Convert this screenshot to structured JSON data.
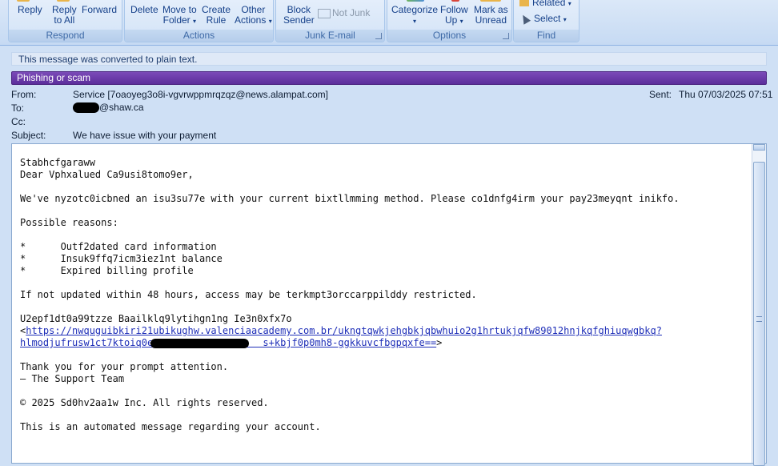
{
  "ribbon": {
    "respond": {
      "label": "Respond",
      "buttons": [
        {
          "l1": "Reply",
          "l2": ""
        },
        {
          "l1": "Reply",
          "l2": "to All"
        },
        {
          "l1": "Forward",
          "l2": ""
        }
      ]
    },
    "actions": {
      "label": "Actions",
      "buttons": [
        {
          "l1": "Delete",
          "l2": ""
        },
        {
          "l1": "Move to",
          "l2": "Folder"
        },
        {
          "l1": "Create",
          "l2": "Rule"
        },
        {
          "l1": "Other",
          "l2": "Actions"
        }
      ]
    },
    "junk": {
      "label": "Junk E-mail",
      "block": {
        "l1": "Block",
        "l2": "Sender"
      },
      "not_junk": "Not Junk"
    },
    "options": {
      "label": "Options",
      "buttons": [
        {
          "l1": "Categorize",
          "l2": ""
        },
        {
          "l1": "Follow",
          "l2": "Up"
        },
        {
          "l1": "Mark as",
          "l2": "Unread"
        }
      ]
    },
    "find": {
      "label": "Find",
      "related": "Related",
      "select": "Select"
    }
  },
  "notice": "This message was converted to plain text.",
  "phishing_banner": "Phishing or scam",
  "header": {
    "from_label": "From:",
    "from_value": "Service [7oaoyeg3o8i-vgvrwppmrqzqz@news.alampat.com]",
    "to_label": "To:",
    "to_value": "@shaw.ca",
    "cc_label": "Cc:",
    "subject_label": "Subject:",
    "subject_value": "We have issue with your payment",
    "sent_label": "Sent:",
    "sent_value": "Thu 07/03/2025 07:51"
  },
  "message": {
    "line1": "Stabhcfgaraww",
    "line2": "Dear Vphxalued Ca9usi8tomo9er,",
    "line3": "We've nyzotc0icbned an isu3su77e with your current bixtllmming method. Please co1dnfg4irm your pay23meyqnt inikfo.",
    "line4": "Possible reasons:",
    "bullet1": "*      Outf2dated card information",
    "bullet2": "*      Insuk9ffq7icm3iez1nt balance",
    "bullet3": "*      Expired billing profile",
    "line5": "If not updated within 48 hours, access may be terkmpt3orccarppilddy restricted.",
    "line6": "U2epf1dt0a99tzze Baailklq9lytihgn1ng Ie3n0xfx7o",
    "url_open": "<",
    "url1": "https://nwquguibkiri21ubikughw.valenciaacademy.com.br/ukngtqwkjehgbkjqbwhuio2g1hrtukjqfw89012hnjkqfghiuqwgbkq?",
    "url2": "hlmodjufrusw1ct7ktoiq0e                   s+kbjf0p0mh8-ggkkuvcfbgpqxfe==",
    "url_close": ">",
    "line7": "Thank you for your prompt attention.",
    "line8": "— The Support Team",
    "line9": "© 2025 Sd0hv2aa1w Inc. All rights reserved.",
    "line10": "This is an automated message regarding your account."
  }
}
